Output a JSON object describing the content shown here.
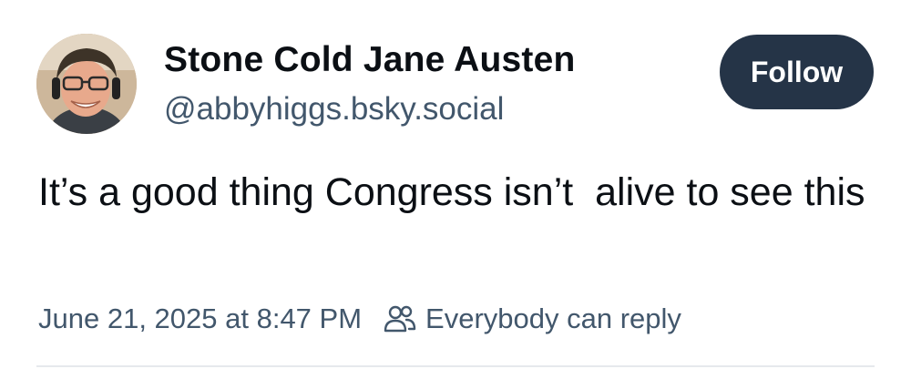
{
  "author": {
    "display_name": "Stone Cold Jane Austen",
    "handle": "@abbyhiggs.bsky.social"
  },
  "actions": {
    "follow_label": "Follow"
  },
  "post": {
    "text": "It’s a good thing Congress isn’t  alive to see this",
    "timestamp": "June 21, 2025 at 8:47 PM",
    "reply_setting": "Everybody can reply"
  },
  "icons": {
    "reply_setting_icon": "people-icon"
  },
  "colors": {
    "follow_button_bg": "#253447",
    "secondary_text": "#42576c",
    "primary_text": "#0b0f14"
  }
}
